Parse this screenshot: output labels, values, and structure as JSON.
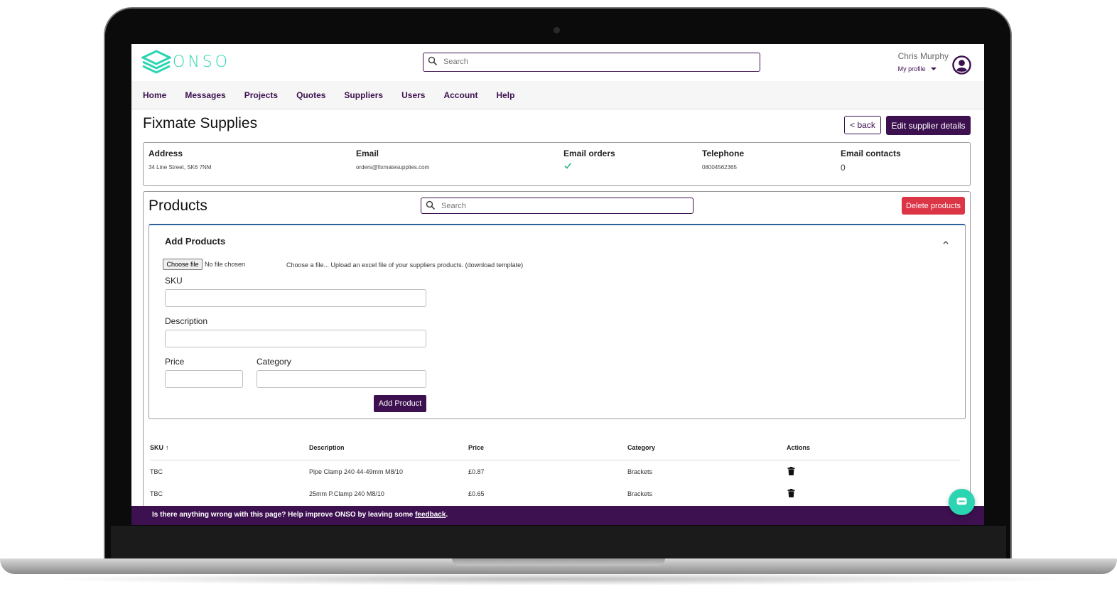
{
  "app": {
    "logo_text": "ONSO",
    "brand_color": "#2cd5b2",
    "primary_color": "#3d1150",
    "danger_color": "#dc3545"
  },
  "header": {
    "search_placeholder": "Search",
    "user_name": "Chris Murphy",
    "profile_label": "My profile"
  },
  "nav": {
    "items": [
      {
        "label": "Home"
      },
      {
        "label": "Messages"
      },
      {
        "label": "Projects"
      },
      {
        "label": "Quotes"
      },
      {
        "label": "Suppliers"
      },
      {
        "label": "Users"
      },
      {
        "label": "Account"
      },
      {
        "label": "Help"
      }
    ]
  },
  "supplier": {
    "title": "Fixmate Supplies",
    "back_label": "< back",
    "edit_label": "Edit supplier details",
    "address_label": "Address",
    "address": "34 Line Street, SK6 7NM",
    "email_label": "Email",
    "email": "orders@fixmatesupplies.com",
    "email_orders_label": "Email orders",
    "email_orders_icon": "check-icon",
    "telephone_label": "Telephone",
    "telephone": "08004562365",
    "email_contacts_label": "Email contacts",
    "email_contacts": "0"
  },
  "products": {
    "title": "Products",
    "search_placeholder": "Search",
    "delete_label": "Delete products",
    "add": {
      "title": "Add Products",
      "choose_file_label": "Choose file",
      "no_file_text": "No file chosen",
      "file_hint": "Choose a file...   Upload an excel file of your suppliers products. (download template)",
      "sku_label": "SKU",
      "description_label": "Description",
      "price_label": "Price",
      "category_label": "Category",
      "add_button_label": "Add Product"
    },
    "table": {
      "headers": {
        "sku": "SKU",
        "sort_indicator": "↑",
        "description": "Description",
        "price": "Price",
        "category": "Category",
        "actions": "Actions"
      },
      "rows": [
        {
          "sku": "TBC",
          "description": "Pipe Clamp 240 44-49mm M8/10",
          "price": "£0.87",
          "category": "Brackets"
        },
        {
          "sku": "TBC",
          "description": "25mm P.Clamp 240 M8/10",
          "price": "£0.65",
          "category": "Brackets"
        }
      ]
    }
  },
  "footer": {
    "text": "Is there anything wrong with this page? Help improve ONSO by leaving some ",
    "link": "feedback",
    "end": "."
  }
}
